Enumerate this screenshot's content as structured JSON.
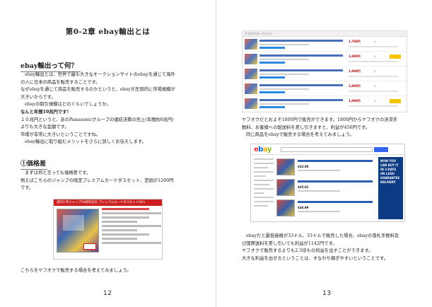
{
  "left_page": {
    "chapter_title": "第0-2章 ebay輸出とは",
    "section_heading": "ebay輸出って何？",
    "intro": [
      "ebay輸出とは、世界で最も大きなオークションサイトのebayを通じて海外",
      "の人に日本の商品を販売することです。",
      "なぜebayを通じて商品を販売するのかというと、ebayが圧倒的に市場規模が",
      "大きいからです。",
      "ebayの取引規模はどのぐらいでしょうか。",
      "なんと年間10兆円です！",
      "１０兆円というと、あのPanasonicグループの連結決算の売上(年間約8兆円)",
      "よりも大きな金額です。",
      "市場が非常に大きいということですね。",
      "ebay輸出に取り組むメリットをさらに詳しくお伝えします。"
    ],
    "sub_heading": "①価格差",
    "price_para": [
      "まずは何と言っても価格差です。",
      "例えばこちらのジャンプの限定プレミアムカードダスセット、定価が1200円",
      "です。"
    ],
    "product_banner": "週刊少年ジャンプ50周年記念 プレミアムカードダスセット50's",
    "closing": "こちらをヤフオクで販売する場合を考えてみましょう。",
    "page_number": "12"
  },
  "right_page": {
    "listing_header": "ヤフオク!オークション",
    "listings": [
      {
        "price": "1,760円",
        "count": "1",
        "time": "2日"
      },
      {
        "price": "1,800円",
        "count": "1",
        "time": "2日"
      },
      {
        "price": "1,800円",
        "count": "1",
        "time": "2日"
      },
      {
        "price": "1,800円",
        "count": "1",
        "time": "2日"
      },
      {
        "price": "1,800円",
        "count": "1",
        "time": "2日"
      }
    ],
    "para1": [
      "ヤフオクだとおよそ1800円で販売ができます。1800円からヤフオクの決済手",
      "数料、お客様への配送料を差し引きますと、利益が456円です。",
      "同じ商品をebayで販売する場合を考えてみましょう。"
    ],
    "ebay_items": [
      {
        "price": "$33.00"
      },
      {
        "price": "$35.01"
      },
      {
        "price": "$36.99"
      }
    ],
    "ebay_ad": "NOW YOU CAN BUY IT IN 3 DAYS OR LESS! GUARANTEE DELIVERY",
    "para2": [
      "ebayだと最低価格が33ドル、33ドルで販売した場合、ebayの落札手数料及",
      "び国際送料を差し引いても利益が1142円です。",
      "ヤフオクで販売するよりも2.5倍もの利益を出すことができます。",
      "大きな利益を出せるということは、すなわち稼ぎやすいということです。"
    ],
    "page_number": "13"
  }
}
